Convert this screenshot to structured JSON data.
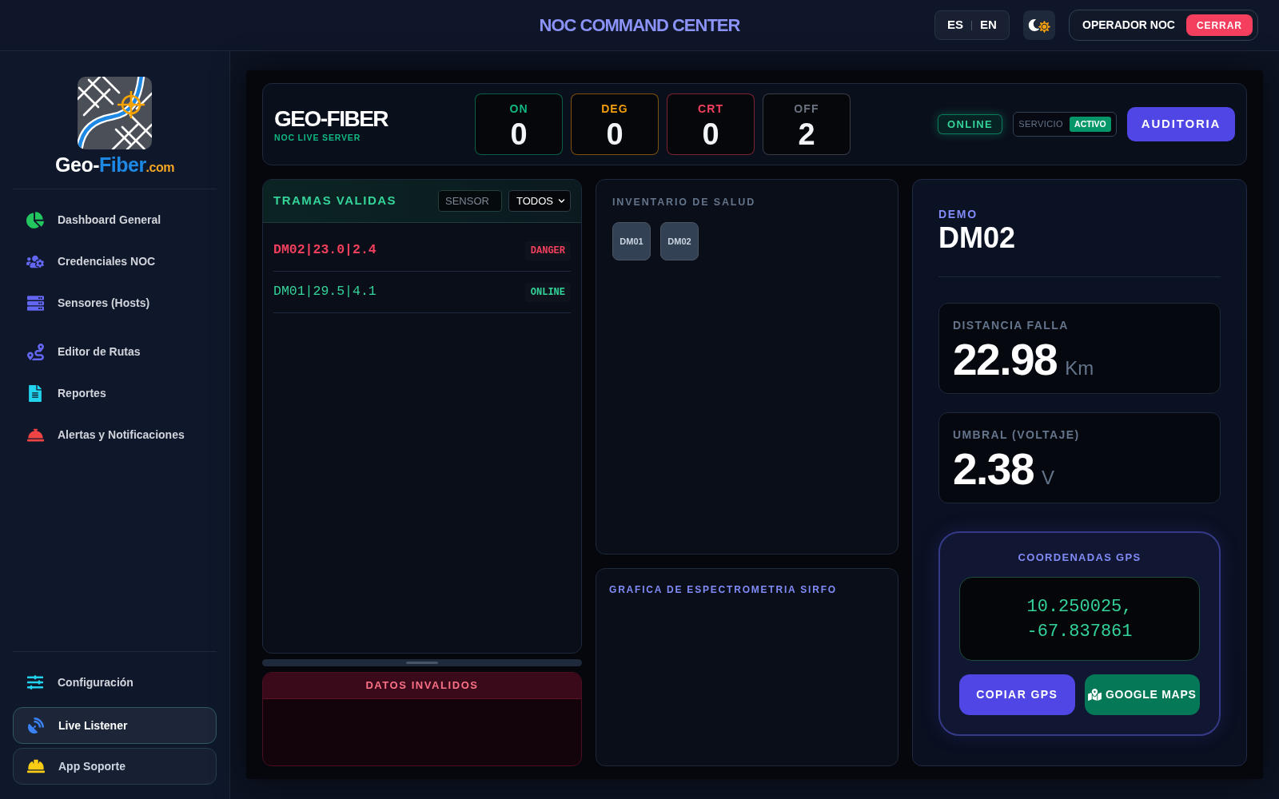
{
  "header": {
    "title": "NOC COMMAND CENTER",
    "languages": [
      "ES",
      "EN"
    ],
    "operator": "OPERADOR NOC",
    "logout_button": "CERRAR"
  },
  "sidebar": {
    "brand": [
      "Geo-",
      "Fiber",
      ".com"
    ],
    "nav_groups": [
      {
        "items": [
          {
            "label": "Dashboard General",
            "selected": false
          },
          {
            "label": "Credenciales NOC",
            "selected": false
          },
          {
            "label": "Sensores (Hosts)",
            "selected": false
          }
        ]
      },
      {
        "items": [
          {
            "label": "Editor de Rutas",
            "selected": false
          },
          {
            "label": "Reportes",
            "selected": false
          },
          {
            "label": "Alertas y Notificaciones",
            "selected": false
          }
        ]
      }
    ],
    "footer_items": [
      {
        "label": "Configuración",
        "kind": "link",
        "selected": false
      },
      {
        "label": "Live Listener",
        "kind": "button",
        "selected": true
      },
      {
        "label": "App Soporte",
        "kind": "button",
        "selected": false
      }
    ]
  },
  "overview": {
    "title": "GEO-FIBER",
    "subtitle": "NOC LIVE SERVER",
    "counters": [
      {
        "label": "ON",
        "value": "0",
        "color": "#10b981"
      },
      {
        "label": "DEG",
        "value": "0",
        "color": "#f59e0b"
      },
      {
        "label": "CRT",
        "value": "0",
        "color": "#f43f5e"
      },
      {
        "label": "OFF",
        "value": "2",
        "color": "#6b7280"
      }
    ],
    "connection": "ONLINE",
    "service": {
      "label": "SERVICIO",
      "status": "ACTIVO"
    },
    "audit_button": "AUDITORIA"
  },
  "valid_frames": {
    "title": "TRAMAS VALIDAS",
    "sensor_field": {
      "placeholder": "SENSOR"
    },
    "status_select": {
      "value": "TODOS"
    },
    "rows": [
      {
        "text": "DM02|23.0|2.4",
        "status": "DANGER",
        "kind": "danger"
      },
      {
        "text": "DM01|29.5|4.1",
        "status": "ONLINE",
        "kind": "online"
      }
    ]
  },
  "invalid_frames": {
    "title": "DATOS INVALIDOS"
  },
  "health_inventory": {
    "title": "INVENTARIO DE SALUD",
    "devices": [
      "DM01",
      "DM02"
    ]
  },
  "spectrometry": {
    "title": "GRAFICA DE ESPECTROMETRIA SIRFO"
  },
  "detail": {
    "label": "DEMO",
    "device": "DM02",
    "metrics": [
      {
        "label": "DISTANCIA FALLA",
        "value": "22.98",
        "unit": "Km"
      },
      {
        "label": "UMBRAL (VOLTAJE)",
        "value": "2.38",
        "unit": "V"
      }
    ],
    "gps": {
      "title": "COORDENADAS GPS",
      "coordinates": "10.250025, -67.837861",
      "copy_button": "COPIAR GPS",
      "maps_button": "GOOGLE MAPS"
    }
  }
}
